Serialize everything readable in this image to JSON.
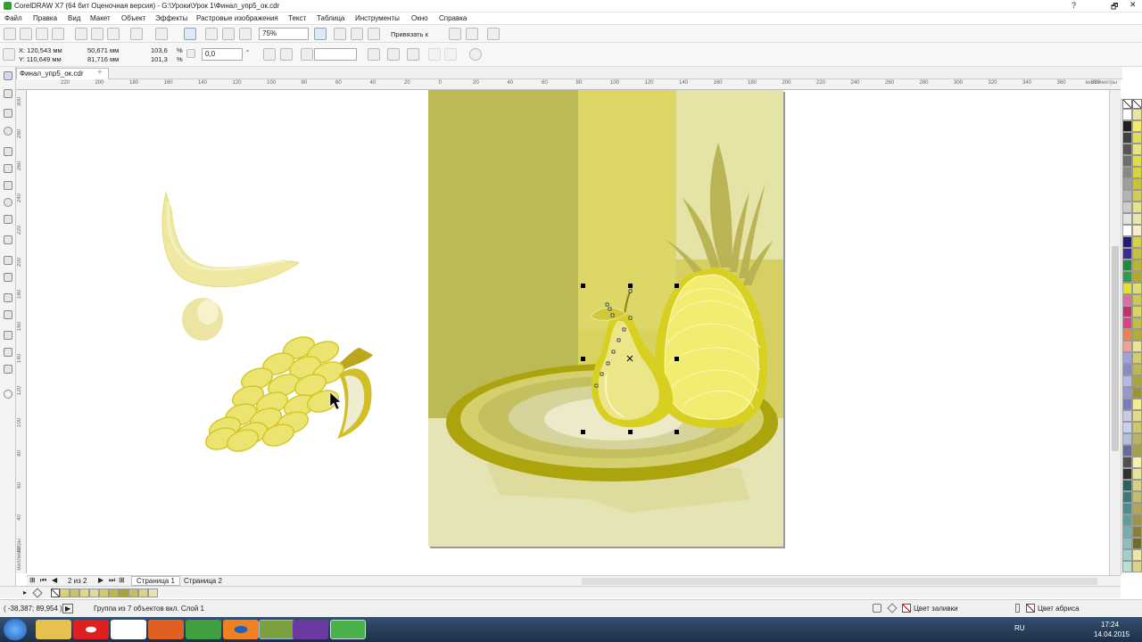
{
  "window": {
    "title": "CorelDRAW X7 (64 бит Оценочная версия) - G:\\Уроки\\Урок 1\\Финал_упр5_ок.cdr",
    "controls": [
      "?",
      "🗗",
      "✕"
    ]
  },
  "menu": [
    "Файл",
    "Правка",
    "Вид",
    "Макет",
    "Объект",
    "Эффекты",
    "Растровые изображения",
    "Текст",
    "Таблица",
    "Инструменты",
    "Окно",
    "Справка"
  ],
  "toolbar": {
    "zoom": "75%",
    "snap_label": "Привязать к"
  },
  "propbar": {
    "x": "X: 120,543 мм",
    "y": "Y: 110,649 мм",
    "width": "50,671 мм",
    "height": "81,716 мм",
    "scale_x": "103,6",
    "scale_y": "101,3",
    "pct": "%",
    "rotation": "0,0",
    "deg": "°"
  },
  "doc_tab": "Финал_упр5_ок.cdr",
  "hruler": {
    "ticks": [
      "220",
      "200",
      "180",
      "160",
      "140",
      "120",
      "100",
      "80",
      "60",
      "40",
      "20",
      "0",
      "20",
      "40",
      "60",
      "80",
      "100",
      "120",
      "140",
      "160",
      "180",
      "200",
      "220",
      "240",
      "260",
      "280",
      "300",
      "320",
      "340",
      "360",
      "380"
    ],
    "unit": "миллиметры"
  },
  "vruler": {
    "ticks": [
      "300",
      "280",
      "260",
      "240",
      "220",
      "200",
      "180",
      "160",
      "140",
      "120",
      "100",
      "80",
      "60",
      "40",
      "20",
      "0"
    ],
    "unit": "миллиметры"
  },
  "pages": {
    "counter": "2 из 2",
    "items": [
      "Страница 1",
      "Страница 2"
    ]
  },
  "status": {
    "coords": "( -38,387; 89,954 )",
    "info": "Группа из 7 объектов вкл. Слой 1",
    "fill": "Цвет заливки",
    "outline": "Цвет абриса"
  },
  "taskbar": {
    "lang": "RU",
    "time": "17:24",
    "date": "14.04.2015"
  },
  "colors": {
    "accent": "#4a7cc0",
    "bg_page": "#e6e3b4",
    "dark": "#bcb957",
    "gold": "#d8d24e",
    "yellow": "#f2ea4a"
  },
  "palette_col1": [
    "#ffffff",
    "#202020",
    "#404040",
    "#555555",
    "#6e6e6e",
    "#888888",
    "#9e9e9e",
    "#b4b4b4",
    "#cccccc",
    "#e4e4e4",
    "#ffffff",
    "#1e1e7a",
    "#3a2a9e",
    "#1f8a3a",
    "#28a050",
    "#e8e030",
    "#d86fa5",
    "#c8306c",
    "#e0408a",
    "#f08050",
    "#f2a090",
    "#a0a0e0",
    "#8a8ac8",
    "#b8b8e8",
    "#9898d0",
    "#7a7ac0",
    "#d0c8e8",
    "#c8d0f0",
    "#b0c0e0",
    "#6a6a9a",
    "#505050",
    "#303030",
    "#2a6060",
    "#3a7a7a",
    "#4a9090",
    "#5aa0a0",
    "#70b0b0",
    "#88c0c0",
    "#a0d0c8",
    "#b8e0d0"
  ],
  "palette_col2": [
    "#e8e6a0",
    "#f0ec70",
    "#dedc60",
    "#e8e480",
    "#e0dc50",
    "#d8d440",
    "#c8c438",
    "#d0cc60",
    "#e6e28c",
    "#e8e6b0",
    "#f2f0c4",
    "#d4d050",
    "#c4c040",
    "#b8b438",
    "#acaa34",
    "#e0dc78",
    "#ccc858",
    "#d8d468",
    "#c0bc48",
    "#b0ac40",
    "#e8e498",
    "#d0cc70",
    "#bcb858",
    "#a8a448",
    "#989438",
    "#f0ec98",
    "#e0dc88",
    "#ccc870",
    "#b8b460",
    "#a4a050",
    "#f4f0b0",
    "#e8e4a0",
    "#d4d088",
    "#c0bc70",
    "#aca860",
    "#989450",
    "#848040",
    "#706c30",
    "#ece8a8",
    "#d8d490"
  ],
  "doc_swatches": [
    "#d8d474",
    "#c8c468",
    "#dcd88c",
    "#e0dc98",
    "#d0cc70",
    "#bcb84c",
    "#a8a43c",
    "#c4c060",
    "#d8d48a",
    "#e6e3b4"
  ]
}
